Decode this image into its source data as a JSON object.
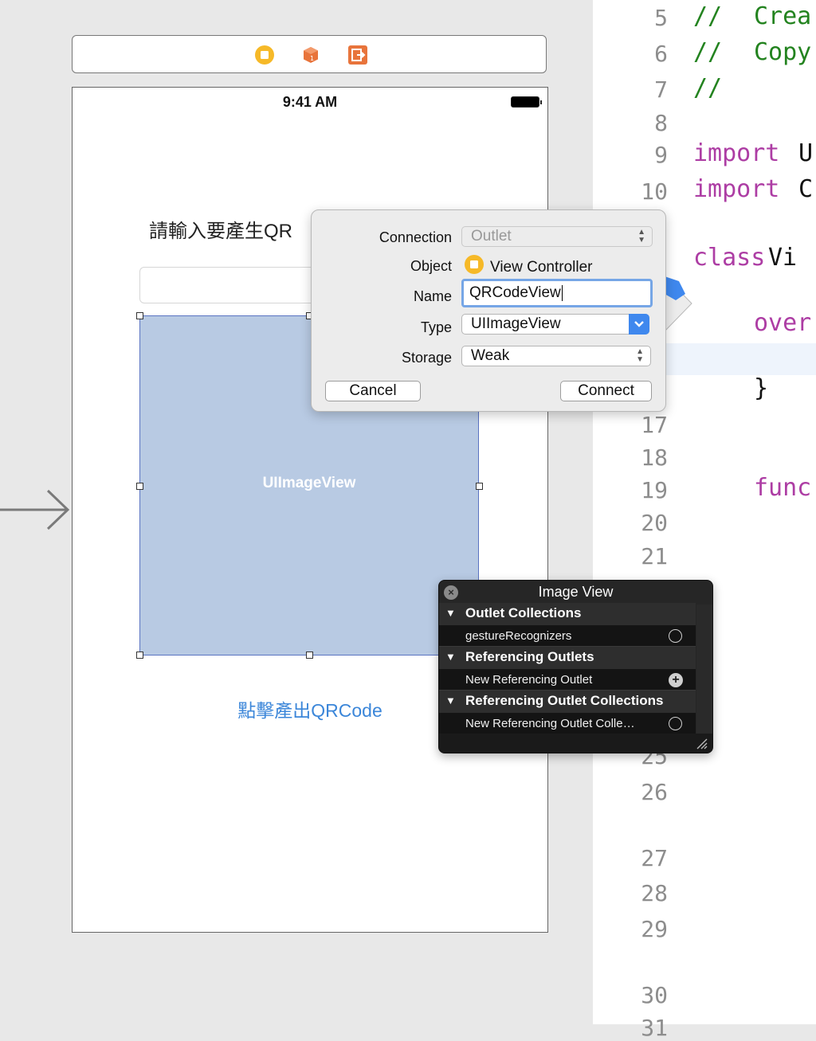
{
  "status_bar": {
    "time": "9:41 AM"
  },
  "dock_icons": [
    "view-controller-icon",
    "first-responder-icon",
    "exit-icon"
  ],
  "storyboard": {
    "prompt_label": "請輸入要產生QR",
    "image_view_label": "UIImageView",
    "generate_button": "點擊產出QRCode"
  },
  "editor": {
    "lines": [
      {
        "num": "5",
        "code": [
          "//",
          "Crea"
        ]
      },
      {
        "num": "6",
        "code": [
          "//",
          "Copy"
        ]
      },
      {
        "num": "7",
        "code": [
          "//"
        ]
      },
      {
        "num": "8"
      },
      {
        "num": "9",
        "code": [
          "import",
          "U"
        ]
      },
      {
        "num": "10",
        "code": [
          "import",
          "C"
        ]
      },
      {
        "num": "",
        "code": [
          "class",
          "Vi"
        ]
      },
      {
        "num": "",
        "code": [
          "over"
        ]
      },
      {
        "num": "",
        "code": [
          "}"
        ]
      },
      {
        "num": "17"
      },
      {
        "num": "18"
      },
      {
        "num": "19",
        "code": [
          "func"
        ]
      },
      {
        "num": "20"
      },
      {
        "num": "21"
      },
      {
        "num": "25"
      },
      {
        "num": "26"
      },
      {
        "num": "27"
      },
      {
        "num": "28"
      },
      {
        "num": "29"
      },
      {
        "num": "30"
      },
      {
        "num": "31"
      }
    ]
  },
  "connection_popover": {
    "connection_label": "Connection",
    "connection_value": "Outlet",
    "object_label": "Object",
    "object_value": "View Controller",
    "name_label": "Name",
    "name_value": "QRCodeView",
    "type_label": "Type",
    "type_value": "UIImageView",
    "storage_label": "Storage",
    "storage_value": "Weak",
    "cancel_label": "Cancel",
    "connect_label": "Connect"
  },
  "hud": {
    "title": "Image View",
    "sections": [
      {
        "label": "Outlet Collections",
        "row": "gestureRecognizers",
        "row_icon": "empty-circle-icon"
      },
      {
        "label": "Referencing Outlets",
        "row": "New Referencing Outlet",
        "row_icon": "plus-circle-icon"
      },
      {
        "label": "Referencing Outlet Collections",
        "row": "New Referencing Outlet Colle…",
        "row_icon": "empty-circle-icon"
      }
    ]
  },
  "colors": {
    "keyword": "#ad3da4",
    "comment": "#23831f",
    "line_number": "#8d8d8d",
    "link_blue": "#3b86d9",
    "image_view_fill": "#b8cae3",
    "accent_blue": "#3f88ee"
  }
}
